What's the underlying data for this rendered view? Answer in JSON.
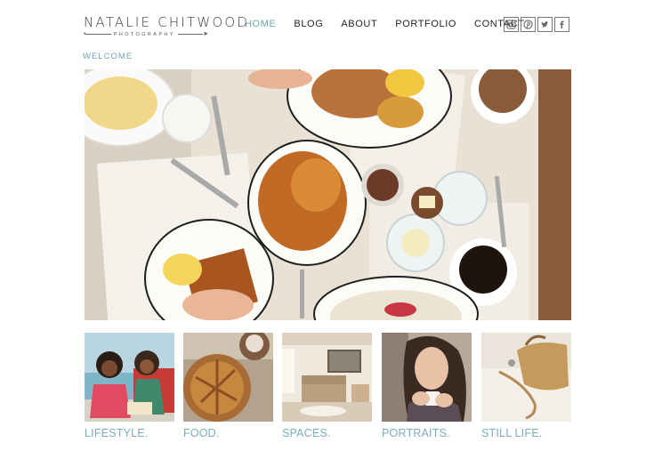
{
  "brand": {
    "name": "NATALIE CHITWOOD",
    "tagline": "PHOTOGRAPHY"
  },
  "nav": {
    "items": [
      {
        "label": "HOME",
        "active": true
      },
      {
        "label": "BLOG",
        "active": false
      },
      {
        "label": "ABOUT",
        "active": false
      },
      {
        "label": "PORTFOLIO",
        "active": false
      },
      {
        "label": "CONTACT",
        "active": false
      }
    ]
  },
  "social": [
    "instagram-icon",
    "pinterest-icon",
    "twitter-icon",
    "facebook-icon"
  ],
  "welcome": "WELCOME",
  "categories": [
    {
      "label": "LIFESTYLE."
    },
    {
      "label": "FOOD."
    },
    {
      "label": "SPACES."
    },
    {
      "label": "PORTRAITS."
    },
    {
      "label": "STILL LIFE."
    }
  ],
  "colors": {
    "accent": "#6fa3b2",
    "label": "#7aadbb",
    "text": "#222222"
  }
}
